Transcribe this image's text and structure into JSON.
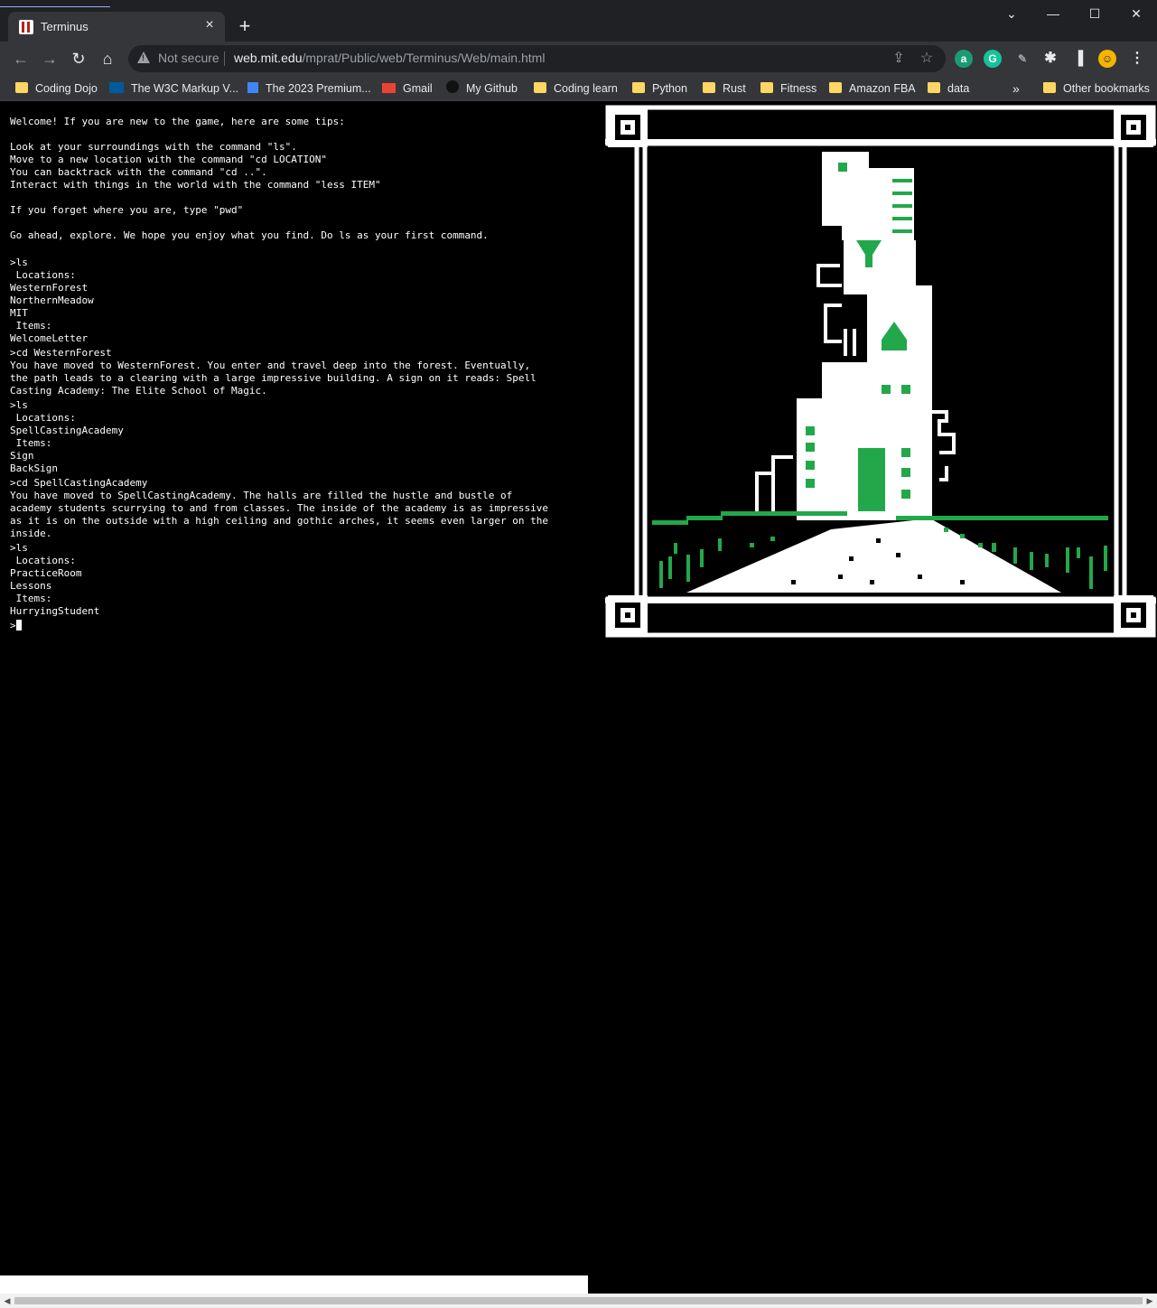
{
  "browser": {
    "tab_title": "Terminus",
    "tab_close": "×",
    "new_tab": "+",
    "security_label": "Not secure",
    "url_domain": "web.mit.edu",
    "url_path": "/mprat/Public/web/Terminus/Web/main.html",
    "window_controls": {
      "collapse": "⌄",
      "minimize": "—",
      "maximize": "☐",
      "close": "✕"
    },
    "nav": {
      "back": "←",
      "forward": "→",
      "reload": "↻",
      "home": "⌂"
    },
    "extensions": {
      "a": "a",
      "g": "G"
    }
  },
  "bookmarks": {
    "items": [
      {
        "label": "Coding Dojo",
        "icon": "folder-icon"
      },
      {
        "label": "The W3C Markup V...",
        "icon": "w3c-icon"
      },
      {
        "label": "The 2023 Premium...",
        "icon": "doc-icon"
      },
      {
        "label": "Gmail",
        "icon": "gmail-icon"
      },
      {
        "label": "My Github",
        "icon": "github-icon"
      },
      {
        "label": "Coding learn",
        "icon": "folder-icon"
      },
      {
        "label": "Python",
        "icon": "folder-icon"
      },
      {
        "label": "Rust",
        "icon": "folder-icon"
      },
      {
        "label": "Fitness",
        "icon": "folder-icon"
      },
      {
        "label": "Amazon FBA",
        "icon": "folder-icon"
      },
      {
        "label": "data",
        "icon": "folder-icon"
      }
    ],
    "overflow": "»",
    "other": "Other bookmarks"
  },
  "terminal": {
    "intro": [
      "Welcome! If you are new to the game, here are some tips:",
      "",
      "Look at your surroundings with the command \"ls\".",
      "Move to a new location with the command \"cd LOCATION\"",
      "You can backtrack with the command \"cd ..\".",
      "Interact with things in the world with the command \"less ITEM\"",
      "",
      "If you forget where you are, type \"pwd\"",
      "",
      "Go ahead, explore. We hope you enjoy what you find. Do ls as your first command.",
      ""
    ],
    "blocks": [
      {
        "command": ">ls",
        "output": [
          " Locations:",
          "WesternForest",
          "NorthernMeadow",
          "MIT",
          " Items:",
          "WelcomeLetter"
        ]
      },
      {
        "command": ">cd WesternForest",
        "output": [
          "You have moved to WesternForest. You enter and travel deep into the forest. Eventually,",
          "the path leads to a clearing with a large impressive building. A sign on it reads: Spell",
          "Casting Academy: The Elite School of Magic."
        ]
      },
      {
        "command": ">ls",
        "output": [
          " Locations:",
          "SpellCastingAcademy",
          " Items:",
          "Sign",
          "BackSign"
        ]
      },
      {
        "command": ">cd SpellCastingAcademy",
        "output": [
          "You have moved to SpellCastingAcademy. The halls are filled the hustle and bustle of",
          "academy students scurrying to and from classes. The inside of the academy is as impressive",
          "as it is on the outside with a high ceiling and gothic arches, it seems even larger on the",
          "inside."
        ]
      },
      {
        "command": ">ls",
        "output": [
          " Locations:",
          "PracticeRoom",
          "Lessons",
          " Items:",
          "HurryingStudent"
        ]
      }
    ],
    "prompt": ">"
  },
  "art": {
    "accent_color": "#22a84a",
    "subject": "spell-casting-academy-tower"
  },
  "scrollbar": {
    "left": "◀",
    "right": "▶"
  }
}
